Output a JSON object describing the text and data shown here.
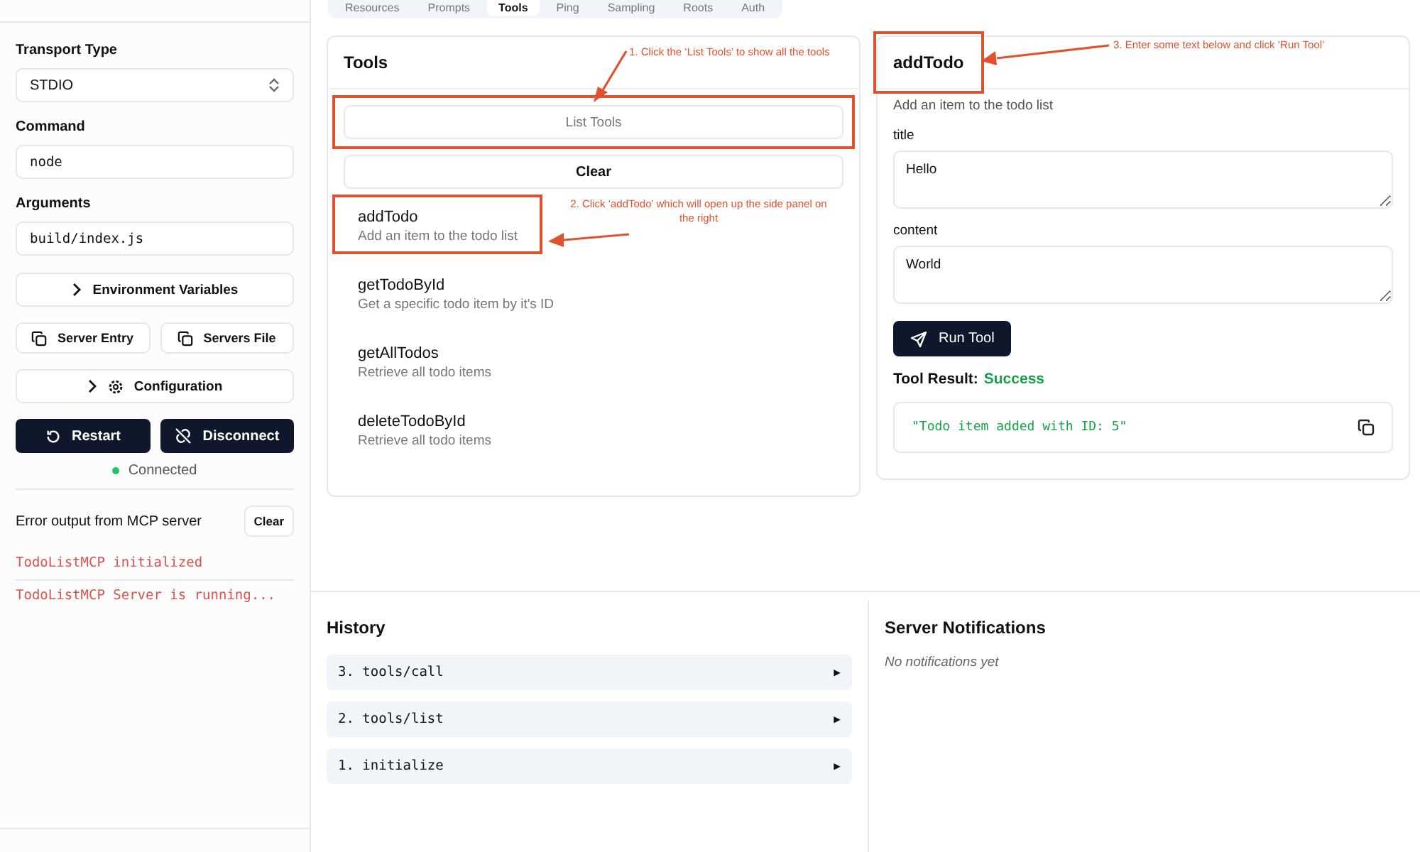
{
  "tabs": [
    {
      "label": "Resources",
      "selected": false
    },
    {
      "label": "Prompts",
      "selected": false
    },
    {
      "label": "Tools",
      "selected": true
    },
    {
      "label": "Ping",
      "selected": false
    },
    {
      "label": "Sampling",
      "selected": false
    },
    {
      "label": "Roots",
      "selected": false
    },
    {
      "label": "Auth",
      "selected": false
    }
  ],
  "sidebar": {
    "transport_type": {
      "label": "Transport Type",
      "value": "STDIO"
    },
    "command": {
      "label": "Command",
      "value": "node"
    },
    "arguments": {
      "label": "Arguments",
      "value": "build/index.js"
    },
    "env_button": "Environment Variables",
    "server_entry_button": "Server Entry",
    "servers_file_button": "Servers File",
    "configuration_button": "Configuration",
    "restart_button": "Restart",
    "disconnect_button": "Disconnect",
    "status": "Connected",
    "connected": true,
    "error_title": "Error output from MCP server",
    "clear_button": "Clear",
    "error_lines": [
      "TodoListMCP initialized",
      "TodoListMCP Server is running..."
    ]
  },
  "tools_panel": {
    "title": "Tools",
    "list_button": "List Tools",
    "list_button_annotated": true,
    "annotation": "1. Click the ‘List Tools’ to show all the tools",
    "clear_button": "Clear",
    "item_annotation": "2. Click ‘addTodo’ which will open up the side panel on the right",
    "tools": [
      {
        "name": "addTodo",
        "description": "Add an item to the todo list",
        "annotated": true
      },
      {
        "name": "getTodoById",
        "description": "Get a specific todo item by it's ID",
        "annotated": false
      },
      {
        "name": "getAllTodos",
        "description": "Retrieve all todo items",
        "annotated": false
      },
      {
        "name": "deleteTodoById",
        "description": "Retrieve all todo items",
        "annotated": false
      }
    ]
  },
  "tool_detail": {
    "title": "addTodo",
    "title_annotated": true,
    "annotation": "3. Enter some text below and click ‘Run Tool’",
    "description": "Add an item to the todo list",
    "fields": [
      {
        "label": "title",
        "value": "Hello"
      },
      {
        "label": "content",
        "value": "World"
      }
    ],
    "run_button": "Run Tool",
    "result_label": "Tool Result:",
    "result_status": "Success",
    "result_text": "\"Todo item added with ID: 5\""
  },
  "history": {
    "title": "History",
    "items": [
      "3. tools/call",
      "2. tools/list",
      "1. initialize"
    ],
    "expand_glyph": "▶"
  },
  "notifications": {
    "title": "Server Notifications",
    "empty_text": "No notifications yet"
  }
}
